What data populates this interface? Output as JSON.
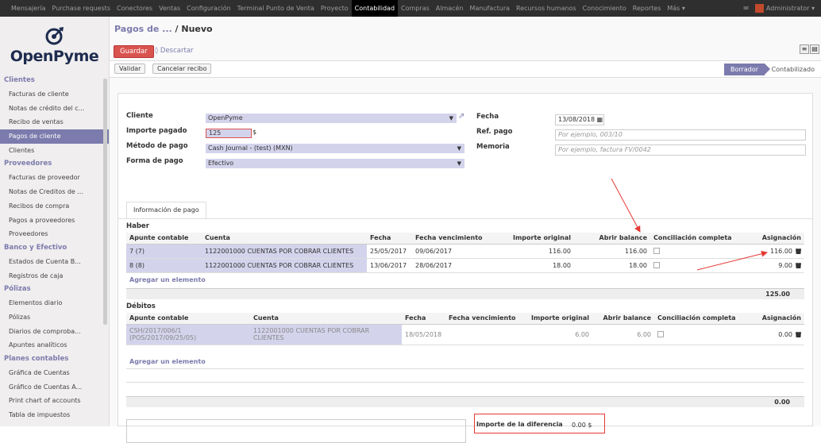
{
  "topnav": {
    "items": [
      "Mensajería",
      "Purchase requests",
      "Conectores",
      "Ventas",
      "Configuración",
      "Terminal Punto de Venta",
      "Proyecto",
      "Contabilidad",
      "Compras",
      "Almacén",
      "Manufactura",
      "Recursos humanos",
      "Conocimiento",
      "Reportes",
      "Más ▾"
    ],
    "active_index": 7,
    "user": "Administrator ▾"
  },
  "brand": {
    "name": "OpenPyme"
  },
  "sidebar": {
    "sections": [
      {
        "title": "Clientes",
        "items": [
          "Facturas de cliente",
          "Notas de crédito del c...",
          "Recibo de ventas",
          "Pagos de cliente",
          "Clientes"
        ]
      },
      {
        "title": "Proveedores",
        "items": [
          "Facturas de proveedor",
          "Notas de Creditos de ...",
          "Recibos de compra",
          "Pagos a proveedores",
          "Proveedores"
        ]
      },
      {
        "title": "Banco y Efectivo",
        "items": [
          "Estados de Cuenta B...",
          "Registros de caja"
        ]
      },
      {
        "title": "Pólizas",
        "items": [
          "Elementos diario",
          "Pólizas",
          "Diarios de comproba...",
          "Apuntes analíticos"
        ]
      },
      {
        "title": "Planes contables",
        "items": [
          "Gráfica de Cuentas",
          "Gráfico de Cuentas A...",
          "Print chart of accounts",
          "Tabla de impuestos"
        ]
      }
    ],
    "active_item": "Pagos de cliente"
  },
  "breadcrumb": {
    "parent": "Pagos de ...",
    "current": "/ Nuevo"
  },
  "toolbar": {
    "save": "Guardar",
    "discard": "Descartar"
  },
  "statusbar": {
    "validate": "Validar",
    "cancel": "Cancelar recibo",
    "state_active": "Borrador",
    "state_next": "Contabilizado"
  },
  "form": {
    "cliente_label": "Cliente",
    "cliente": "OpenPyme",
    "importe_label": "Importe pagado",
    "importe": "125",
    "currency": "$",
    "metodo_label": "Método de pago",
    "metodo": "Cash Journal - (test) (MXN)",
    "forma_label": "Forma de pago",
    "forma": "Efectivo",
    "fecha_label": "Fecha",
    "fecha": "13/08/2018",
    "ref_label": "Ref. pago",
    "ref_placeholder": "Por ejemplo, 003/10",
    "memoria_label": "Memoria",
    "memoria_placeholder": "Por ejemplo, factura FV/0042"
  },
  "tab": {
    "label": "Información de pago"
  },
  "haber": {
    "title": "Haber",
    "columns": [
      "Apunte contable",
      "Cuenta",
      "Fecha",
      "Fecha vencimiento",
      "Importe original",
      "Abrir balance",
      "Conciliación completa",
      "Asignación"
    ],
    "rows": [
      {
        "apunte": "7 (7)",
        "cuenta": "1122001000 CUENTAS POR COBRAR CLIENTES",
        "fecha": "25/05/2017",
        "venc": "09/06/2017",
        "original": "116.00",
        "balance": "116.00",
        "asignacion": "116.00"
      },
      {
        "apunte": "8 (8)",
        "cuenta": "1122001000 CUENTAS POR COBRAR CLIENTES",
        "fecha": "13/06/2017",
        "venc": "28/06/2017",
        "original": "18.00",
        "balance": "18.00",
        "asignacion": "9.00"
      }
    ],
    "add": "Agregar un elemento",
    "total": "125.00"
  },
  "debitos": {
    "title": "Débitos",
    "columns": [
      "Apunte contable",
      "Cuenta",
      "Fecha",
      "Fecha vencimiento",
      "Importe original",
      "Abrir balance",
      "Conciliación completa",
      "Asignación"
    ],
    "rows": [
      {
        "apunte": "CSH/2017/006/1 (POS/2017/09/25/05)",
        "cuenta": "1122001000 CUENTAS POR COBRAR CLIENTES",
        "fecha": "18/05/2018",
        "venc": "",
        "original": "6.00",
        "balance": "6.00",
        "asignacion": "0.00"
      }
    ],
    "add": "Agregar un elemento",
    "total": "0.00"
  },
  "diferencia": {
    "label": "Importe de la diferencia",
    "value": "0.00 $"
  },
  "colors": {
    "accent": "#7c7bad",
    "danger": "#d9534f",
    "highlight": "#d4d3ec",
    "arrow": "#e53935"
  }
}
